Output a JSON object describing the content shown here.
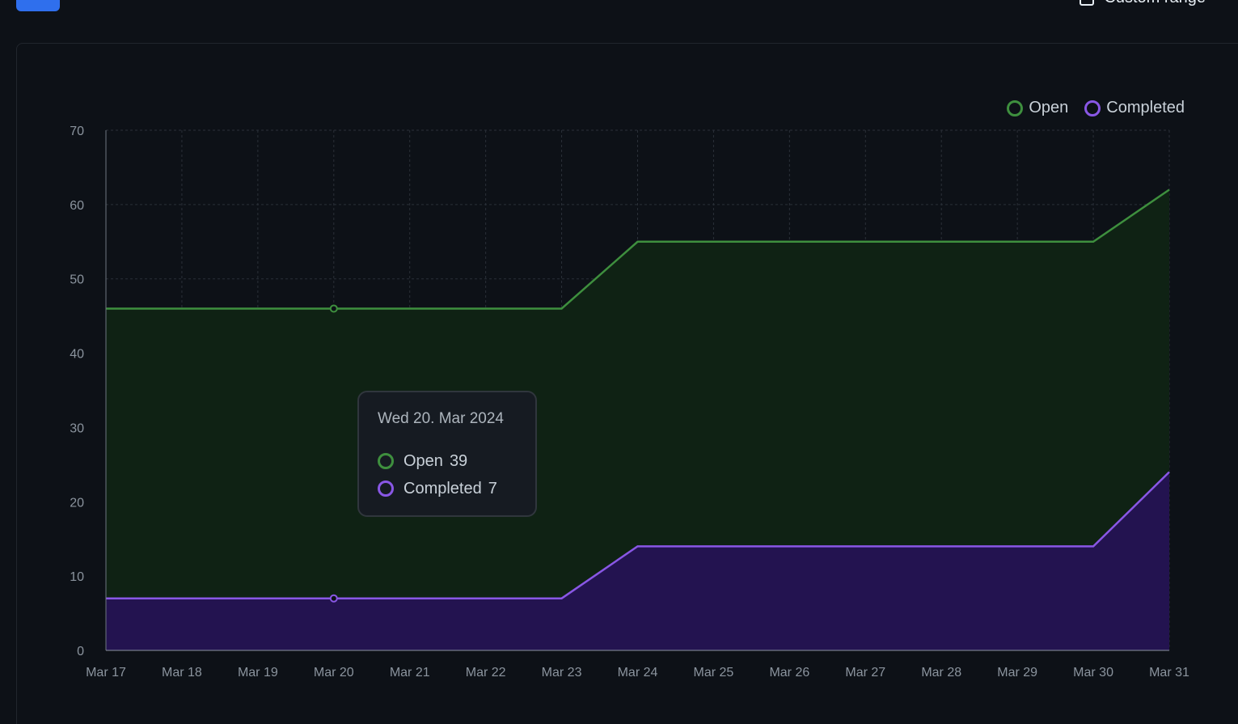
{
  "toolbar": {
    "range_label": "Custom range"
  },
  "chart_data": {
    "type": "area",
    "x": [
      "Mar 17",
      "Mar 18",
      "Mar 19",
      "Mar 20",
      "Mar 21",
      "Mar 22",
      "Mar 23",
      "Mar 24",
      "Mar 25",
      "Mar 26",
      "Mar 27",
      "Mar 28",
      "Mar 29",
      "Mar 30",
      "Mar 31"
    ],
    "stacked": true,
    "series": [
      {
        "name": "Completed",
        "color": "#8957e5",
        "fill": "#231350",
        "values": [
          7,
          7,
          7,
          7,
          7,
          7,
          7,
          14,
          14,
          14,
          14,
          14,
          14,
          14,
          24
        ]
      },
      {
        "name": "Open",
        "color": "#3fb950",
        "line_color": "#3e8f3e",
        "fill": "#0f2214",
        "values": [
          39,
          39,
          39,
          39,
          39,
          39,
          39,
          41,
          41,
          41,
          41,
          41,
          41,
          41,
          38
        ]
      }
    ],
    "yticks": [
      0,
      10,
      20,
      30,
      40,
      50,
      60,
      70
    ],
    "ylim": [
      0,
      70
    ],
    "grid": true,
    "legend_position": "top-right",
    "legend": [
      "Open",
      "Completed"
    ],
    "tooltip": {
      "title": "Wed 20. Mar 2024",
      "index": 3,
      "rows": [
        {
          "label": "Open",
          "value": "39"
        },
        {
          "label": "Completed",
          "value": "7"
        }
      ]
    }
  }
}
